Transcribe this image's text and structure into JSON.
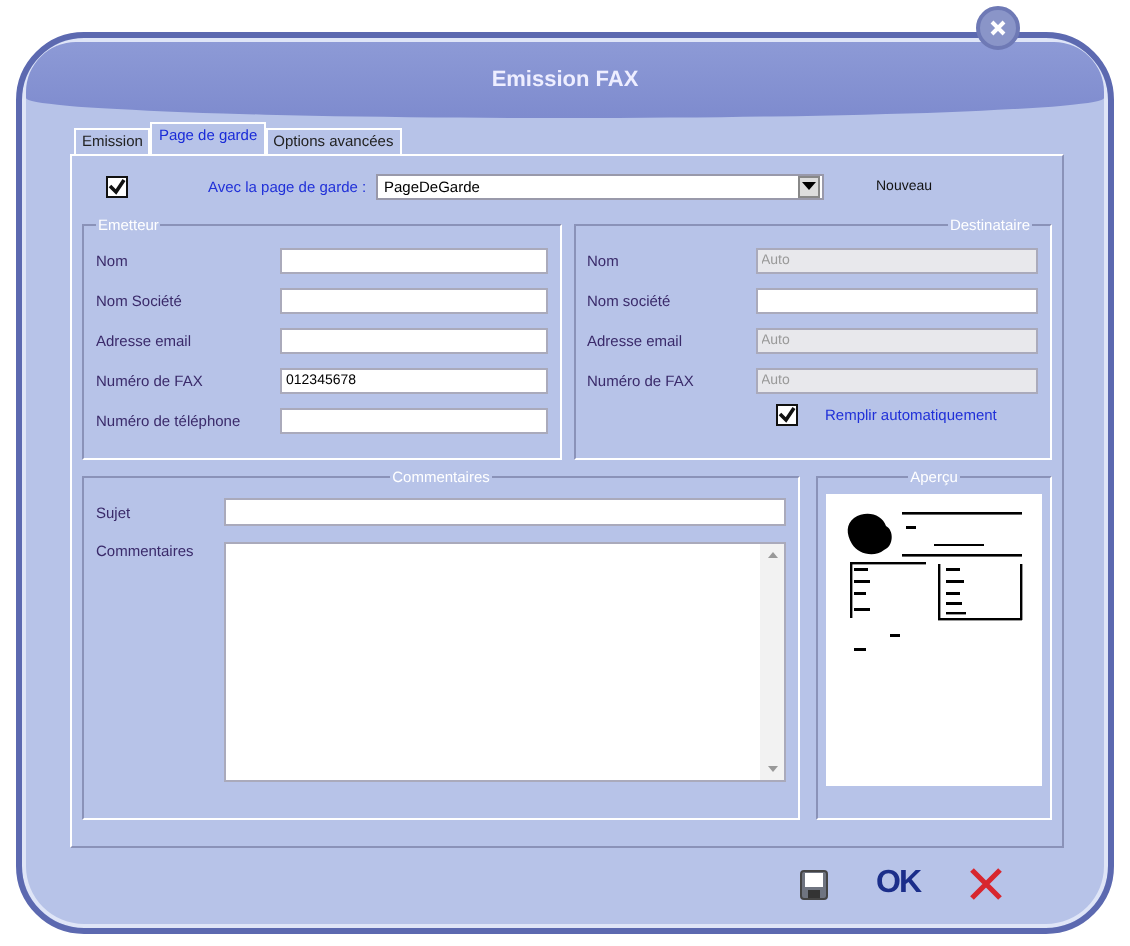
{
  "window": {
    "title": "Emission FAX"
  },
  "tabs": [
    {
      "label": "Emission",
      "selected": false
    },
    {
      "label": "Page de garde",
      "selected": true
    },
    {
      "label": "Options avancées",
      "selected": false
    }
  ],
  "cover_page": {
    "label": "Avec la page de garde :",
    "checked": true,
    "template": "PageDeGarde",
    "new_button": "Nouveau"
  },
  "sender": {
    "legend": "Emetteur",
    "fields": [
      {
        "label": "Nom",
        "disabled": false
      },
      {
        "label": "Nom Société",
        "disabled": false
      },
      {
        "label": "Adresse email",
        "disabled": false
      },
      {
        "label": "Numéro de FAX",
        "value": "012345678",
        "disabled": false
      },
      {
        "label": "Numéro de téléphone",
        "disabled": false
      }
    ]
  },
  "recipient": {
    "legend": "Destinataire",
    "fields": [
      {
        "label": "Nom",
        "value": "Auto",
        "disabled": true
      },
      {
        "label": "Nom société",
        "disabled": false
      },
      {
        "label": "Adresse email",
        "value": "Auto",
        "disabled": true
      },
      {
        "label": "Numéro de FAX",
        "value": "Auto",
        "disabled": true
      }
    ],
    "autofill": {
      "label": "Remplir automatiquement",
      "checked": true
    }
  },
  "comments": {
    "legend": "Commentaires",
    "subject_label": "Sujet",
    "comments_label": "Commentaires"
  },
  "preview": {
    "legend": "Aperçu"
  },
  "buttons": [
    {
      "kind": "save"
    },
    {
      "kind": "ok",
      "label": "OK"
    },
    {
      "kind": "cancel"
    }
  ]
}
